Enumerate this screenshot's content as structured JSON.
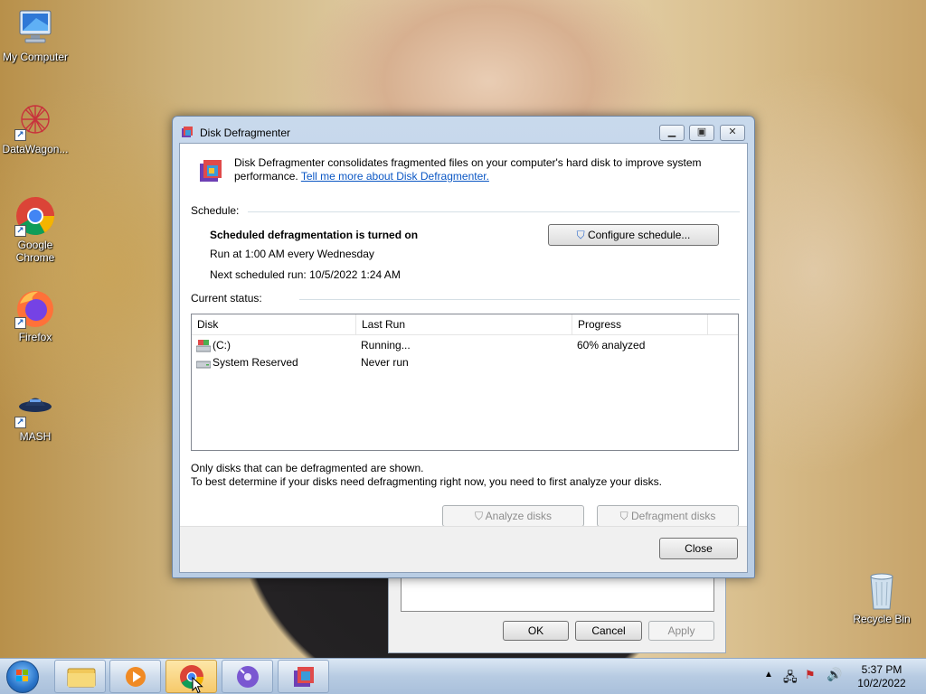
{
  "desktop": {
    "icons": [
      {
        "label": "My Computer",
        "icon": "computer-icon"
      },
      {
        "label": "DataWagon...",
        "icon": "datawagon-icon"
      },
      {
        "label": "Google Chrome",
        "icon": "chrome-icon"
      },
      {
        "label": "Firefox",
        "icon": "firefox-icon"
      },
      {
        "label": "MASH",
        "icon": "mash-icon"
      },
      {
        "label": "Recycle Bin",
        "icon": "recycle-bin-icon"
      }
    ]
  },
  "window": {
    "title": "Disk Defragmenter",
    "intro_text": "Disk Defragmenter consolidates fragmented files on your computer's hard disk to improve system performance.",
    "intro_link": "Tell me more about Disk Defragmenter.",
    "schedule_label": "Schedule:",
    "schedule_status": "Scheduled defragmentation is turned on",
    "schedule_run": "Run at 1:00 AM every Wednesday",
    "schedule_next": "Next scheduled run: 10/5/2022 1:24 AM",
    "configure_button": "Configure schedule...",
    "current_status_label": "Current status:",
    "columns": [
      "Disk",
      "Last Run",
      "Progress"
    ],
    "disks": [
      {
        "name": "(C:)",
        "last_run": "Running...",
        "progress": "60% analyzed",
        "icon": "system-drive-icon"
      },
      {
        "name": "System Reserved",
        "last_run": "Never run",
        "progress": "",
        "icon": "drive-icon"
      }
    ],
    "note_1": "Only disks that can be defragmented are shown.",
    "note_2": "To best determine if your disks need defragmenting right now, you need to first analyze your disks.",
    "analyze_button": "Analyze disks",
    "defragment_button": "Defragment disks",
    "close_button": "Close"
  },
  "background_dialog": {
    "ok": "OK",
    "cancel": "Cancel",
    "apply": "Apply"
  },
  "taskbar": {
    "time": "5:37 PM",
    "date": "10/2/2022"
  }
}
